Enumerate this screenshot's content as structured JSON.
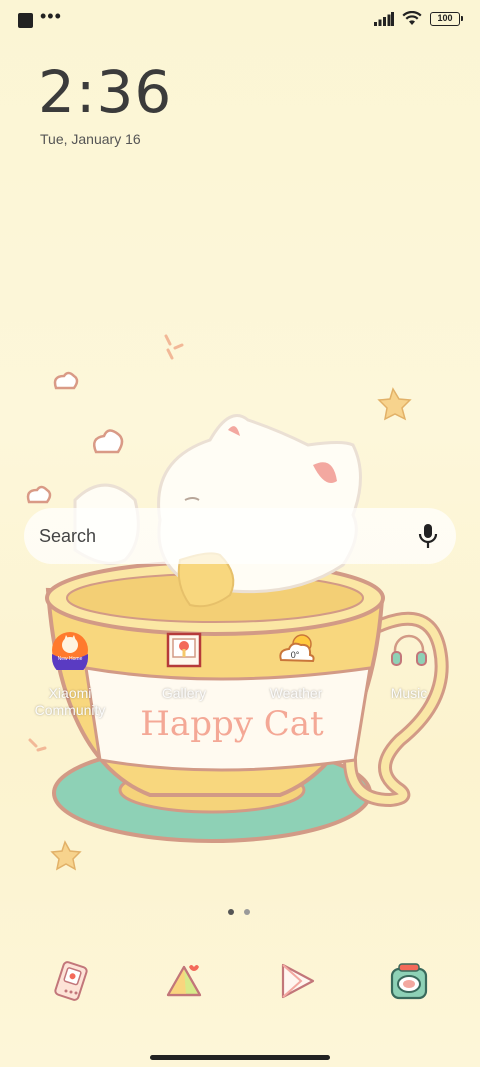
{
  "status_bar": {
    "battery": "100",
    "icons": [
      "app-notification-icon",
      "more-dots-icon",
      "signal-icon",
      "wifi-icon",
      "battery-icon"
    ]
  },
  "lockscreen": {
    "time": "2:36",
    "date": "Tue, January 16"
  },
  "search": {
    "label": "Search"
  },
  "apps": [
    {
      "name": "xiaomi-community",
      "label": "Xiaomi Community",
      "icon": "xiaomi-community-icon"
    },
    {
      "name": "gallery",
      "label": "Gallery",
      "icon": "gallery-icon"
    },
    {
      "name": "weather",
      "label": "Weather",
      "icon": "weather-icon",
      "badge": "0°"
    },
    {
      "name": "music",
      "label": "Music",
      "icon": "headphones-icon"
    }
  ],
  "xiaomi_badge": "New Home",
  "wallpaper": {
    "text": "Happy Cat"
  },
  "pager": {
    "pages": 2,
    "current": 1
  },
  "dock": [
    {
      "name": "phone",
      "icon": "phone-icon"
    },
    {
      "name": "messages",
      "icon": "messages-icon"
    },
    {
      "name": "play-store",
      "icon": "play-store-icon"
    },
    {
      "name": "camera",
      "icon": "camera-icon"
    }
  ],
  "colors": {
    "background": "#fbf5d4",
    "cup": "#f8d77e",
    "saucer": "#8ed1b6",
    "outline": "#d29a86",
    "accent_pink": "#f3a8a0"
  }
}
